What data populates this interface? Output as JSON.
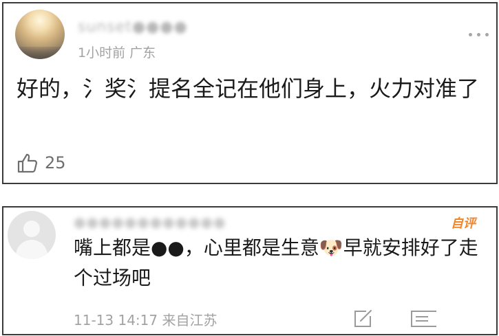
{
  "post": {
    "author": "sunset●●●●",
    "meta": "1小时前 广东",
    "text": "好的，氵奖氵提名全记在他们身上，火力对准了",
    "likes": "25"
  },
  "reply": {
    "author": "●●●●●●●●●●●●",
    "badge": "自评",
    "text": "嘴上都是●●，心里都是生意🐶早就安排好了走个过场吧",
    "meta": "11-13 14:17 来自江苏"
  },
  "icons": {
    "more": "more-dots-icon",
    "like": "thumbs-up-icon",
    "edit": "edit-square-icon",
    "comment": "comment-icon"
  }
}
